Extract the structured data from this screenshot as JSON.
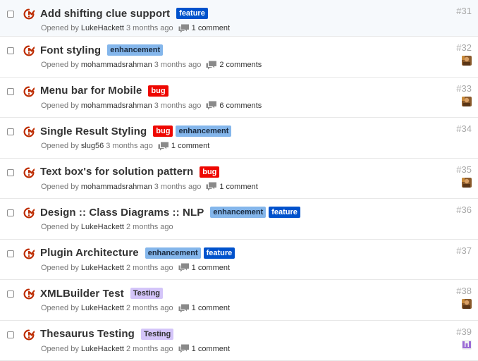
{
  "meta_prefix": "Opened by",
  "label_colors": {
    "feature": "#0052cc",
    "enhancement": "#84b6eb",
    "bug": "#ee0701",
    "Testing": "#d4c5f9"
  },
  "issues": [
    {
      "title": "Add shifting clue support",
      "labels": [
        "feature"
      ],
      "user": "LukeHackett",
      "time": "3 months ago",
      "comments": "1 comment",
      "number": "#31",
      "avatar": ""
    },
    {
      "title": "Font styling",
      "labels": [
        "enhancement"
      ],
      "user": "mohammadsrahman",
      "time": "3 months ago",
      "comments": "2 comments",
      "number": "#32",
      "avatar": "photo-avatar"
    },
    {
      "title": "Menu bar for Mobile",
      "labels": [
        "bug"
      ],
      "user": "mohammadsrahman",
      "time": "3 months ago",
      "comments": "6 comments",
      "number": "#33",
      "avatar": "photo-avatar"
    },
    {
      "title": "Single Result Styling",
      "labels": [
        "bug",
        "enhancement"
      ],
      "user": "slug56",
      "time": "3 months ago",
      "comments": "1 comment",
      "number": "#34",
      "avatar": ""
    },
    {
      "title": "Text box's for solution pattern",
      "labels": [
        "bug"
      ],
      "user": "mohammadsrahman",
      "time": "3 months ago",
      "comments": "1 comment",
      "number": "#35",
      "avatar": "photo-avatar"
    },
    {
      "title": "Design :: Class Diagrams :: NLP",
      "labels": [
        "enhancement",
        "feature"
      ],
      "user": "LukeHackett",
      "time": "2 months ago",
      "comments": "",
      "number": "#36",
      "avatar": ""
    },
    {
      "title": "Plugin Architecture",
      "labels": [
        "enhancement",
        "feature"
      ],
      "user": "LukeHackett",
      "time": "2 months ago",
      "comments": "1 comment",
      "number": "#37",
      "avatar": ""
    },
    {
      "title": "XMLBuilder Test",
      "labels": [
        "Testing"
      ],
      "user": "LukeHackett",
      "time": "2 months ago",
      "comments": "1 comment",
      "number": "#38",
      "avatar": "photo-avatar"
    },
    {
      "title": "Thesaurus Testing",
      "labels": [
        "Testing"
      ],
      "user": "LukeHackett",
      "time": "2 months ago",
      "comments": "1 comment",
      "number": "#39",
      "avatar": "identicon-avatar"
    }
  ]
}
